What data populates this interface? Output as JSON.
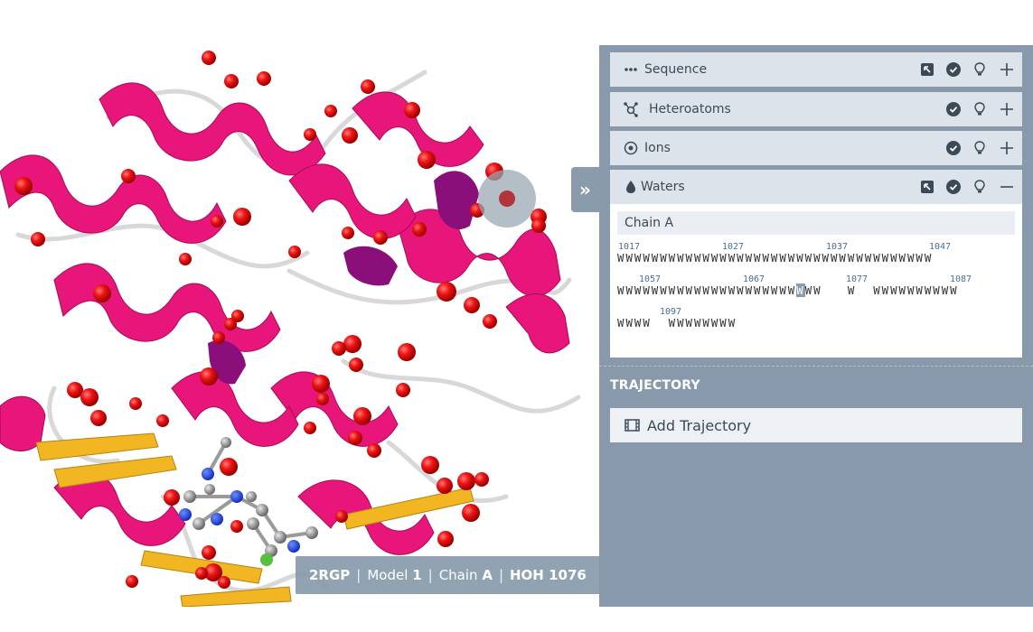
{
  "viewport": {
    "hover_label": {
      "structure": "2RGP",
      "model_prefix": "Model",
      "model": "1",
      "chain_prefix": "Chain",
      "chain": "A",
      "residue": "HOH 1076"
    }
  },
  "panel": {
    "toggle_icon": "»",
    "sections": [
      {
        "title": "Sequence",
        "icon": "dots-icon",
        "expanded": false
      },
      {
        "title": "Heteroatoms",
        "icon": "molecule-icon",
        "expanded": false
      },
      {
        "title": "Ions",
        "icon": "target-icon",
        "expanded": false
      },
      {
        "title": "Waters",
        "icon": "droplet-icon",
        "expanded": true
      }
    ],
    "waters": {
      "chain_label": "Chain A",
      "rows": [
        {
          "numbers": [
            "1017",
            "1027",
            "1037",
            "1047"
          ],
          "residues": "WWWWWWWWWWWWWWWWWWWWWWWWWWWWWWWWWWWWW",
          "highlight_index": -1
        },
        {
          "numbers": [
            "1057",
            "1067",
            "1077",
            "1087"
          ],
          "residues_before": "WWWWWWWWWWWWWWWWWWWWW",
          "residues_highlight": "W",
          "residues_after": "WW   W  WWWWWWWWWW",
          "highlight_index": 21
        },
        {
          "numbers": [
            "1097"
          ],
          "residues": "WWWW  WWWWWWWW",
          "highlight_index": -1
        }
      ]
    },
    "trajectory": {
      "title": "TRAJECTORY",
      "add_label": "Add Trajectory"
    }
  },
  "colors": {
    "panel_bg": "#8799ab",
    "section_bg": "#dde3ea",
    "helix": "#e8157a",
    "sheet": "#f2b623",
    "water": "#e01010",
    "highlight": "#8a9bab"
  }
}
